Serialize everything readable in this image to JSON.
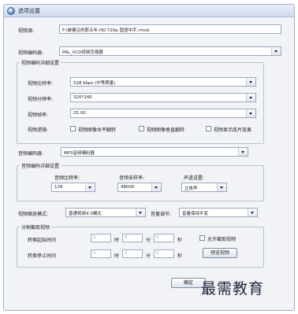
{
  "window": {
    "title": "选项设置"
  },
  "video_source": {
    "label": "视频源:",
    "value": "F:\\被偏注的那五年 HD 720p 国语中字.rmvb"
  },
  "video_encoder": {
    "label": "视频编码器:",
    "value": "PAL_VCD视频压缩器"
  },
  "video_detail": {
    "legend": "视频编码详细设置",
    "bitrate": {
      "label": "视频比特率:",
      "value": "528 kbps (中等质量)"
    },
    "resolution": {
      "label": "视频分辨率:",
      "value": "320*240"
    },
    "framerate": {
      "label": "视频帧率:",
      "value": "25.00"
    },
    "filter": {
      "label": "视频滤镜:",
      "options": [
        "视频图像水平翻转",
        "视频图像垂直翻转",
        "视频显示底片效果"
      ]
    }
  },
  "audio_encoder": {
    "label": "音频编码器:",
    "value": "MP3音频编码器"
  },
  "audio_detail": {
    "legend": "音频编码详细设置",
    "bitrate": {
      "label": "音频比特率:",
      "value": "128"
    },
    "samplerate": {
      "label": "音频采样率:",
      "value": "48000"
    },
    "channel": {
      "label": "声道设置:",
      "value": "立体声"
    }
  },
  "scale": {
    "label": "视频缩放模式:",
    "value": "普通视频4:3模式"
  },
  "volume": {
    "label": "音量调节:",
    "value": "音量保持不变"
  },
  "split": {
    "legend": "分割截取视频",
    "start_label": "转换起始时间",
    "end_label": "转换停止时间",
    "hour_unit": "时",
    "min_unit": "分",
    "sec_unit": "秒",
    "start": {
      "h": "0",
      "m": "0",
      "s": "0"
    },
    "end": {
      "h": "0",
      "m": "0",
      "s": "0"
    },
    "allow_label": "允许截取视频",
    "preview_label": "预览视频"
  },
  "buttons": {
    "ok": "确定"
  },
  "watermark": "最需教育",
  "colors": {
    "window_bg": "#f1f3f7",
    "titlebar": "#cfd9ea",
    "border": "#9aa8bf"
  }
}
